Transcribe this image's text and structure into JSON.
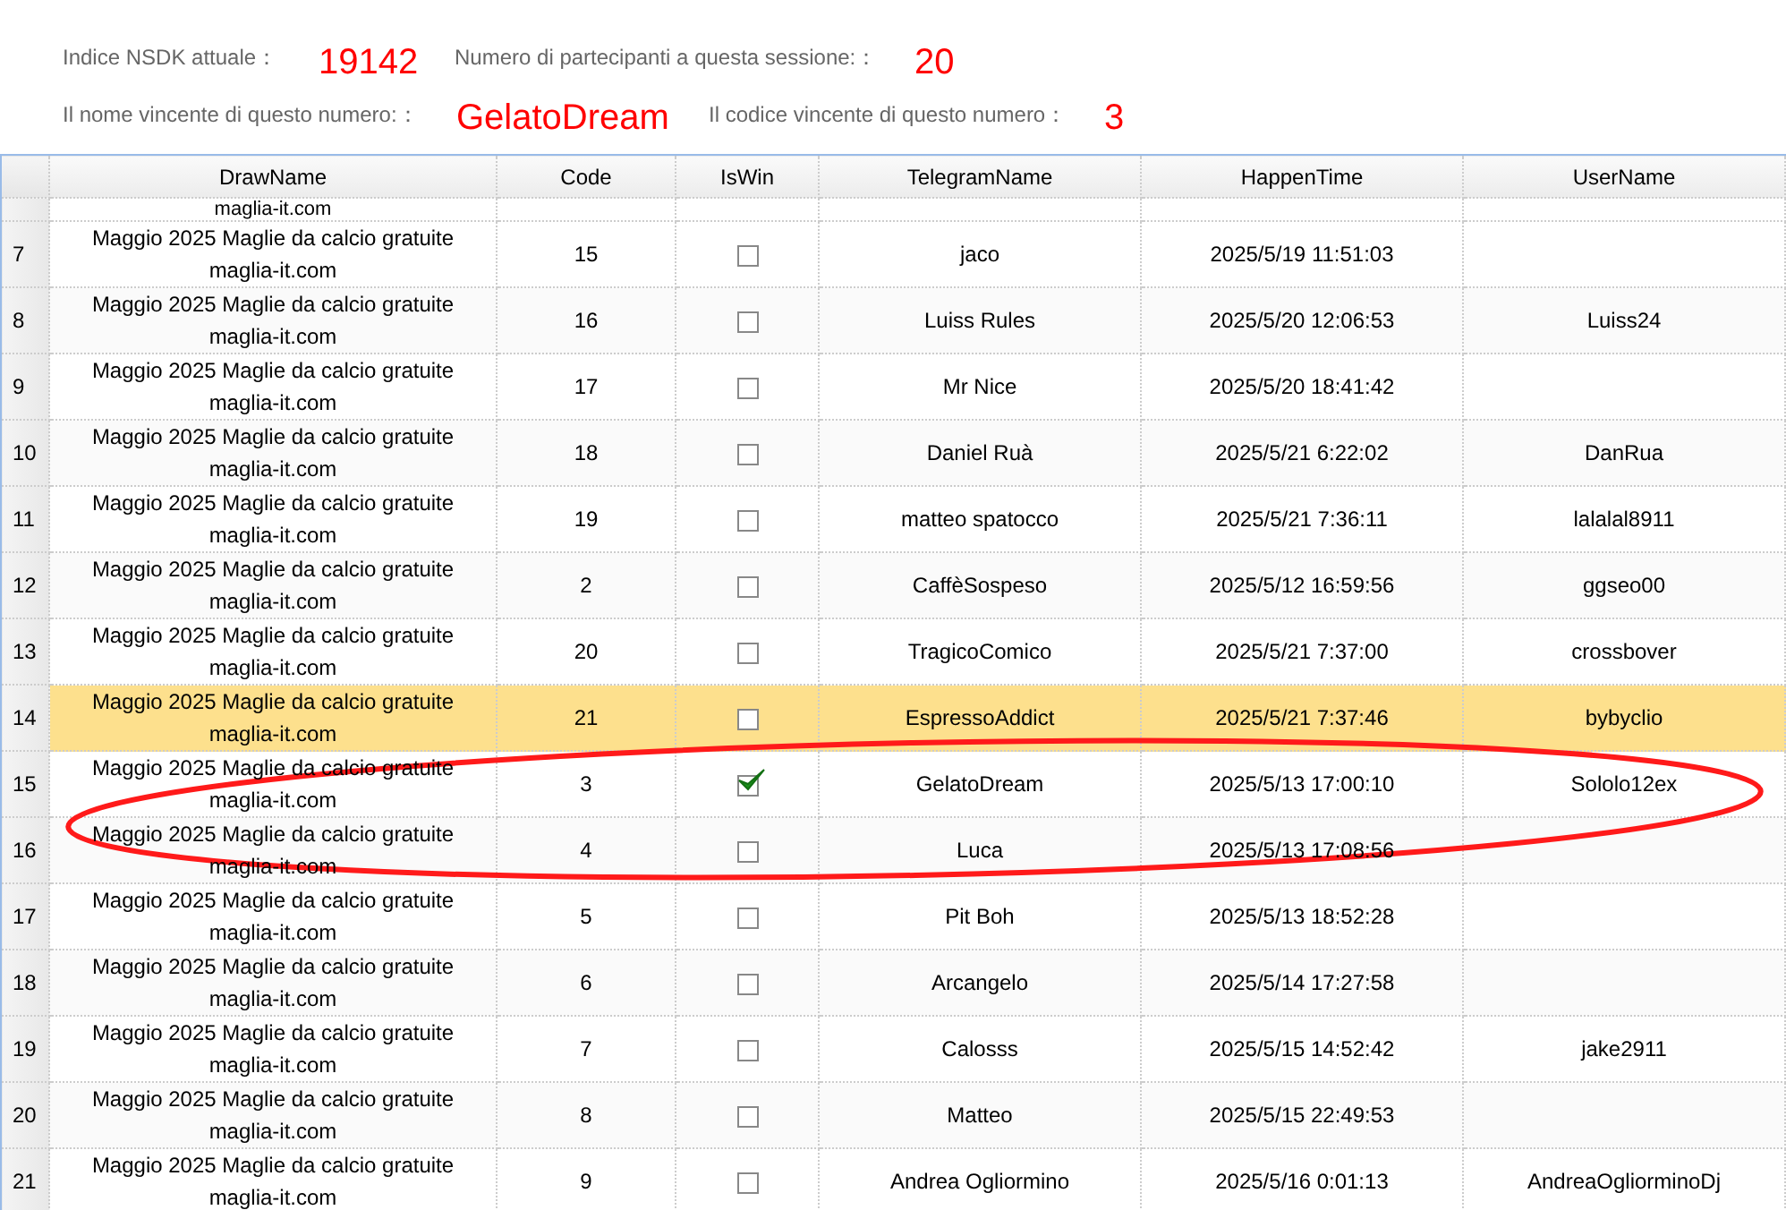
{
  "summary": [
    {
      "label": "Indice NSDK attuale：",
      "value": "19142"
    },
    {
      "label": "Numero di partecipanti a questa sessione:：",
      "value": "20"
    },
    {
      "label": "Il nome vincente di questo numero:：",
      "value": "GelatoDream"
    },
    {
      "label": "Il codice vincente di questo numero：",
      "value": "3"
    }
  ],
  "table": {
    "columns": [
      "DrawName",
      "Code",
      "IsWin",
      "TelegramName",
      "HappenTime",
      "UserName"
    ],
    "partial_row": {
      "draw_name": "maglia-it.com"
    },
    "rows": [
      {
        "number": "7",
        "draw_name": "Maggio 2025 Maglie da calcio gratuite maglia-it.com",
        "code": "15",
        "is_win": false,
        "telegram_name": "jaco",
        "happen_time": "2025/5/19 11:51:03",
        "selected": false
      },
      {
        "number": "8",
        "draw_name": "Maggio 2025 Maglie da calcio gratuite maglia-it.com",
        "code": "16",
        "is_win": false,
        "telegram_name": "Luiss Rules",
        "happen_time": "2025/5/20 12:06:53",
        "user_name": "Luiss24",
        "selected": false
      },
      {
        "number": "9",
        "draw_name": "Maggio 2025 Maglie da calcio gratuite maglia-it.com",
        "code": "17",
        "is_win": false,
        "telegram_name": "Mr Nice",
        "happen_time": "2025/5/20 18:41:42",
        "selected": false
      },
      {
        "number": "10",
        "draw_name": "Maggio 2025 Maglie da calcio gratuite maglia-it.com",
        "code": "18",
        "is_win": false,
        "telegram_name": "Daniel Ruà",
        "happen_time": "2025/5/21 6:22:02",
        "user_name": "DanRua",
        "selected": false
      },
      {
        "number": "11",
        "draw_name": "Maggio 2025 Maglie da calcio gratuite maglia-it.com",
        "code": "19",
        "is_win": false,
        "telegram_name": "matteo spatocco",
        "happen_time": "2025/5/21 7:36:11",
        "user_name": "lalalal8911",
        "selected": false
      },
      {
        "number": "12",
        "draw_name": "Maggio 2025 Maglie da calcio gratuite maglia-it.com",
        "code": "2",
        "is_win": false,
        "telegram_name": "CaffèSospeso",
        "happen_time": "2025/5/12 16:59:56",
        "user_name": "ggseo00",
        "selected": false
      },
      {
        "number": "13",
        "draw_name": "Maggio 2025 Maglie da calcio gratuite maglia-it.com",
        "code": "20",
        "is_win": false,
        "telegram_name": "TragicoComico",
        "happen_time": "2025/5/21 7:37:00",
        "user_name": "crossbover",
        "selected": false
      },
      {
        "number": "14",
        "draw_name": "Maggio 2025 Maglie da calcio gratuite maglia-it.com",
        "code": "21",
        "is_win": false,
        "telegram_name": "EspressoAddict",
        "happen_time": "2025/5/21 7:37:46",
        "user_name": "bybyclio",
        "selected": true
      },
      {
        "number": "15",
        "draw_name": "Maggio 2025 Maglie da calcio gratuite maglia-it.com",
        "code": "3",
        "is_win": true,
        "telegram_name": "GelatoDream",
        "happen_time": "2025/5/13 17:00:10",
        "user_name": "Sololo12ex",
        "selected": false
      },
      {
        "number": "16",
        "draw_name": "Maggio 2025 Maglie da calcio gratuite maglia-it.com",
        "code": "4",
        "is_win": false,
        "telegram_name": "Luca",
        "happen_time": "2025/5/13 17:08:56",
        "selected": false
      },
      {
        "number": "17",
        "draw_name": "Maggio 2025 Maglie da calcio gratuite maglia-it.com",
        "code": "5",
        "is_win": false,
        "telegram_name": "Pit Boh",
        "happen_time": "2025/5/13 18:52:28",
        "selected": false
      },
      {
        "number": "18",
        "draw_name": "Maggio 2025 Maglie da calcio gratuite maglia-it.com",
        "code": "6",
        "is_win": false,
        "telegram_name": "Arcangelo",
        "happen_time": "2025/5/14 17:27:58",
        "selected": false
      },
      {
        "number": "19",
        "draw_name": "Maggio 2025 Maglie da calcio gratuite maglia-it.com",
        "code": "7",
        "is_win": false,
        "telegram_name": "Calosss",
        "happen_time": "2025/5/15 14:52:42",
        "user_name": "jake2911",
        "selected": false
      },
      {
        "number": "20",
        "draw_name": "Maggio 2025 Maglie da calcio gratuite maglia-it.com",
        "code": "8",
        "is_win": false,
        "telegram_name": "Matteo",
        "happen_time": "2025/5/15 22:49:53",
        "selected": false
      },
      {
        "number": "21",
        "draw_name": "Maggio 2025 Maglie da calcio gratuite maglia-it.com",
        "code": "9",
        "is_win": false,
        "telegram_name": "Andrea Ogliormino",
        "happen_time": "2025/5/16 0:01:13",
        "user_name": "AndreaOgliorminoDj",
        "selected": false
      }
    ]
  },
  "annotation": {
    "kind": "ellipse",
    "color": "#ff1a1a"
  }
}
